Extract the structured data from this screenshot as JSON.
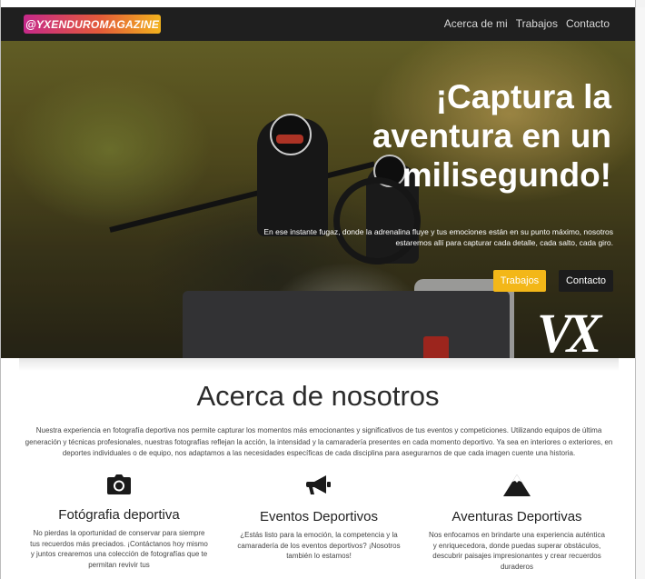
{
  "navbar": {
    "brand": "@YXENDUROMAGAZINE",
    "links": [
      "Acerca de mi",
      "Trabajos",
      "Contacto"
    ]
  },
  "hero": {
    "title": "¡Captura la aventura en un milisegundo!",
    "text": "En ese instante fugaz, donde la adrenalina fluye y tus emociones están en su punto máximo, nosotros estaremos allí para capturar cada detalle, cada salto, cada giro.",
    "buttons": {
      "works": "Trabajos",
      "contact": "Contacto"
    },
    "watermark": "VX",
    "colors": {
      "works_button": "#f3b718",
      "contact_button": "#1c1c1c"
    }
  },
  "about": {
    "title": "Acerca de nosotros",
    "text": "Nuestra experiencia en fotografía deportiva nos permite capturar los momentos más emocionantes y significativos de tus eventos y competiciones. Utilizando equipos de última generación y técnicas profesionales, nuestras fotografías reflejan la acción, la intensidad y la camaradería presentes en cada momento deportivo. Ya sea en interiores o exteriores, en deportes individuales o de equipo, nos adaptamos a las necesidades específicas de cada disciplina para asegurarnos de que cada imagen cuente una historia.",
    "features": [
      {
        "icon": "camera-icon",
        "title": "Fotógrafia deportiva",
        "text": "No pierdas la oportunidad de conservar para siempre tus recuerdos más preciados. ¡Contáctanos hoy mismo y juntos crearemos una colección de fotografías que te permitan revivir tus"
      },
      {
        "icon": "megaphone-icon",
        "title": "Eventos Deportivos",
        "text": "¿Estás listo para la emoción, la competencia y la camaradería de los eventos deportivos? ¡Nosotros también lo estamos!"
      },
      {
        "icon": "mountain-icon",
        "title": "Aventuras Deportivas",
        "text": "Nos enfocamos en brindarte una experiencia auténtica y enriquecedora, donde puedas superar obstáculos, descubrir paisajes impresionantes y crear recuerdos duraderos"
      }
    ]
  }
}
